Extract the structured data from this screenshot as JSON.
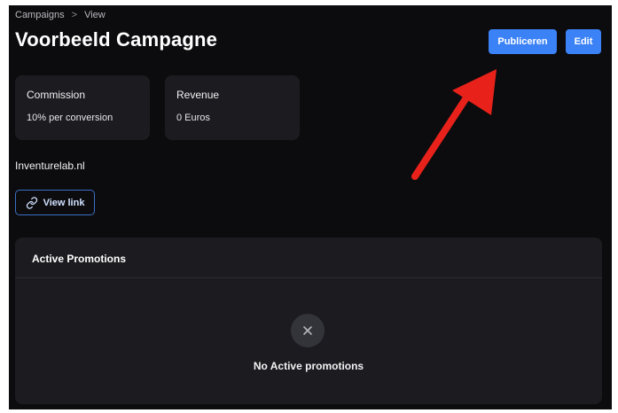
{
  "breadcrumb": {
    "items": [
      "Campaigns",
      "View"
    ],
    "separator": ">"
  },
  "header": {
    "title": "Voorbeeld Campagne",
    "publish_label": "Publiceren",
    "edit_label": "Edit"
  },
  "stats": {
    "commission": {
      "label": "Commission",
      "value": "10% per conversion"
    },
    "revenue": {
      "label": "Revenue",
      "value": "0 Euros"
    }
  },
  "campaign": {
    "domain": "Inventurelab.nl",
    "view_link_label": "View link"
  },
  "promotions": {
    "title": "Active Promotions",
    "empty_message": "No Active promotions"
  },
  "icons": {
    "view_link": "link-icon",
    "empty_state": "close-icon",
    "annotation": "red-arrow-icon"
  },
  "colors": {
    "background": "#0c0c0e",
    "card": "#1c1c20",
    "accent": "#3b82f6",
    "annotation": "#e8221b"
  }
}
